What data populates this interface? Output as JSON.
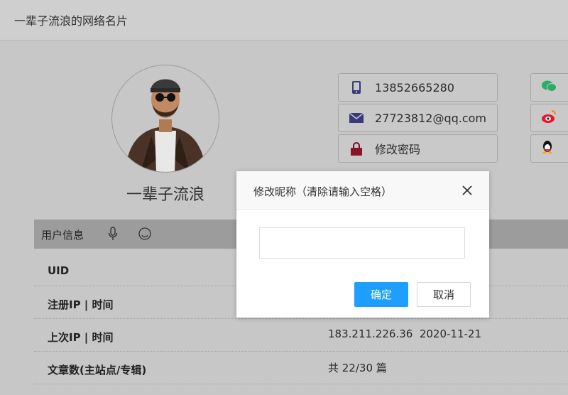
{
  "page": {
    "title": "一辈子流浪的网络名片"
  },
  "profile": {
    "nickname": "一辈子流浪",
    "avatar_icon": "cartoon-avatar-icon"
  },
  "contacts": [
    {
      "icon": "phone-icon",
      "text": "13852665280"
    },
    {
      "icon": "mail-icon",
      "text": "27723812@qq.com"
    },
    {
      "icon": "lock-icon",
      "text": "修改密码"
    }
  ],
  "social": [
    {
      "icon": "wechat-icon",
      "color": "#2aae67"
    },
    {
      "icon": "weibo-icon",
      "color": "#e6162d"
    },
    {
      "icon": "qq-icon",
      "color": "#000000"
    }
  ],
  "userinfo": {
    "title": "用户信息",
    "icons": [
      "microphone-icon",
      "smile-icon"
    ],
    "rows": [
      {
        "label": "UID",
        "value": ""
      },
      {
        "label": "注册IP | 时间",
        "value": ""
      },
      {
        "label": "上次IP | 时间",
        "value": "183.211.226.36  2020-11-21"
      },
      {
        "label": "文章数(主站点/专辑)",
        "value": "共 22/30 篇"
      }
    ]
  },
  "dialog": {
    "title": "修改昵称（清除请输入空格）",
    "input_value": "",
    "input_placeholder": "",
    "confirm_label": "确定",
    "cancel_label": "取消",
    "confirm_color": "#1e9fff"
  }
}
